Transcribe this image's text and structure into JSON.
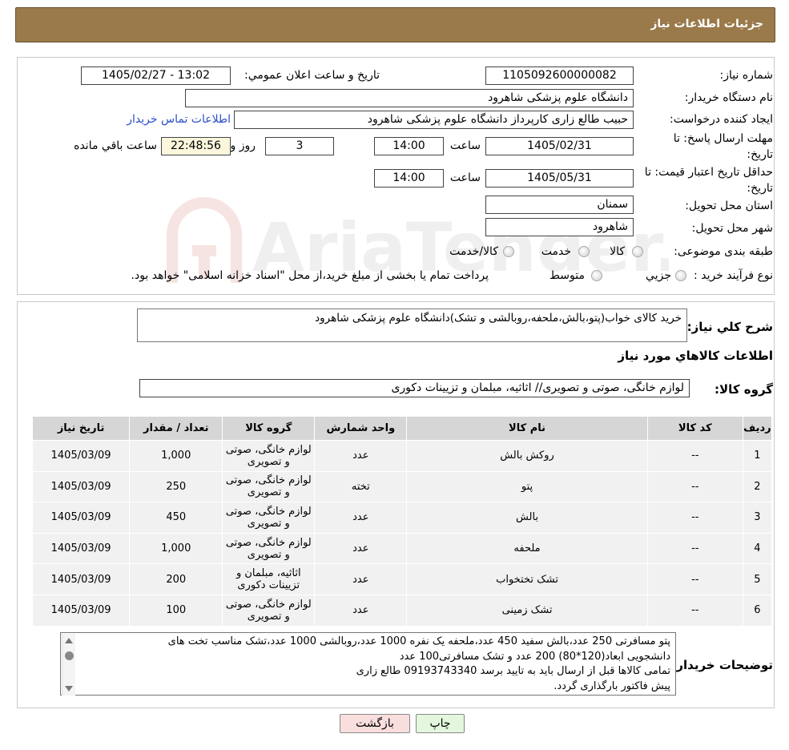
{
  "header": {
    "title": "جزئیات اطلاعات نیاز"
  },
  "form": {
    "need_number_label": "شماره نیاز:",
    "need_number": "1105092600000082",
    "announce_label": "تاريخ و ساعت اعلان عمومي:",
    "announce_value": "1405/02/27 - 13:02",
    "buyer_label": "نام دستگاه خريدار:",
    "buyer_value": "دانشگاه علوم پزشکی شاهرود",
    "creator_label": "ايجاد کننده درخواست:",
    "creator_value": "حبیب طالع زاری کارپرداز دانشگاه علوم پزشکی شاهرود",
    "contact_link": "اطلاعات تماس خريدار",
    "deadline_label_1": "مهلت ارسال پاسخ: تا",
    "deadline_label_2": "تاريخ:",
    "deadline_date": "1405/02/31",
    "time_label": "ساعت",
    "deadline_time": "14:00",
    "days_value": "3",
    "day_and_label": "روز و",
    "remaining_time": "22:48:56",
    "remaining_label": "ساعت باقي مانده",
    "validity_label_1": "حداقل تاريخ اعتبار قيمت: تا",
    "validity_label_2": "تاريخ:",
    "validity_date": "1405/05/31",
    "validity_time": "14:00",
    "province_label": "استان محل تحويل:",
    "province_value": "سمنان",
    "city_label": "شهر محل تحويل:",
    "city_value": "شاهرود",
    "category_label": "طبقه بندی موضوعی:",
    "category_options": [
      "کالا",
      "خدمت",
      "کالا/خدمت"
    ],
    "process_label": "نوع فرآيند خريد :",
    "process_options": [
      "جزيي",
      "متوسط"
    ],
    "process_note": "پرداخت تمام یا بخشی از مبلغ خرید،از محل \"اسناد خزانه اسلامی\" خواهد بود."
  },
  "details": {
    "summary_label": "شرح کلي نياز:",
    "summary_value": "خرید کالای خواب(پتو،بالش،ملحفه،روبالشی و تشک)دانشگاه علوم پزشکی شاهرود",
    "items_title": "اطلاعات کالاهاي مورد نياز",
    "group_label": "گروه کالا:",
    "group_value": "لوازم خانگی، صوتی و تصویری// اثاثیه، مبلمان و تزیینات دکوری",
    "table_headers": [
      "رديف",
      "کد کالا",
      "نام کالا",
      "واحد شمارش",
      "گروه کالا",
      "تعداد / مقدار",
      "تاريخ نياز"
    ],
    "rows": [
      [
        "1",
        "--",
        "روکش بالش",
        "عدد",
        "لوازم خانگی، صوتی و تصویری",
        "1,000",
        "1405/03/09"
      ],
      [
        "2",
        "--",
        "پتو",
        "تخته",
        "لوازم خانگی، صوتی و تصویری",
        "250",
        "1405/03/09"
      ],
      [
        "3",
        "--",
        "بالش",
        "عدد",
        "لوازم خانگی، صوتی و تصویری",
        "450",
        "1405/03/09"
      ],
      [
        "4",
        "--",
        "ملحفه",
        "عدد",
        "لوازم خانگی، صوتی و تصویری",
        "1,000",
        "1405/03/09"
      ],
      [
        "5",
        "--",
        "تشک تختخواب",
        "عدد",
        "اثاثیه، مبلمان و تزیینات دکوری",
        "200",
        "1405/03/09"
      ],
      [
        "6",
        "--",
        "تشک زمینی",
        "عدد",
        "لوازم خانگی، صوتی و تصویری",
        "100",
        "1405/03/09"
      ]
    ],
    "buyer_notes_label": "توضيحات خريدار:",
    "buyer_notes_lines": [
      "پتو مسافرتی 250 عدد،بالش سفید 450 عدد،ملحفه یک نفره 1000 عدد،روبالشی 1000 عدد،تشک مناسب تخت های",
      "دانشجویی ابعاد(120*80) 200 عدد و تشک مسافرتی100 عدد",
      "تمامی کالاها قبل از ارسال باید به تایید برسد 09193743340 طالع زاری",
      "پیش فاکتور بارگذاری گردد."
    ]
  },
  "buttons": {
    "print": "چاپ",
    "back": "بازگشت"
  },
  "watermark": {
    "text": "AriaTender.neT"
  },
  "colors": {
    "header_bg": "#9a7a4b",
    "link": "#2b4ec8",
    "timer_bg": "#fbf6dc",
    "back_btn_bg": "#f9dede",
    "print_btn_bg": "#e3f7df"
  }
}
